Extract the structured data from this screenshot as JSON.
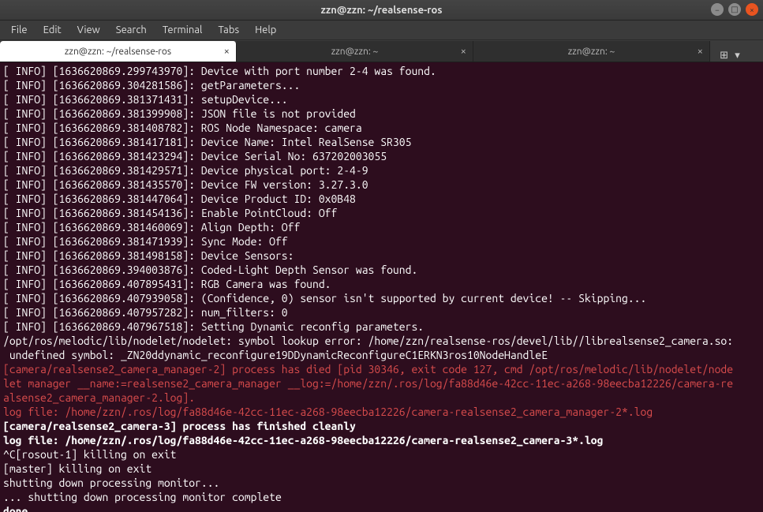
{
  "window": {
    "title": "zzn@zzn: ~/realsense-ros"
  },
  "menu": {
    "file": "File",
    "edit": "Edit",
    "view": "View",
    "search": "Search",
    "terminal": "Terminal",
    "tabs": "Tabs",
    "help": "Help"
  },
  "tabs": [
    {
      "label": "zzn@zzn: ~/realsense-ros",
      "active": true
    },
    {
      "label": "zzn@zzn: ~",
      "active": false
    },
    {
      "label": "zzn@zzn: ~",
      "active": false
    }
  ],
  "lines": [
    {
      "cls": "c-white",
      "text": "[ INFO] [1636620869.299743970]: Device with port number 2-4 was found."
    },
    {
      "cls": "c-white",
      "text": "[ INFO] [1636620869.304281586]: getParameters..."
    },
    {
      "cls": "c-white",
      "text": "[ INFO] [1636620869.381371431]: setupDevice..."
    },
    {
      "cls": "c-white",
      "text": "[ INFO] [1636620869.381399908]: JSON file is not provided"
    },
    {
      "cls": "c-white",
      "text": "[ INFO] [1636620869.381408782]: ROS Node Namespace: camera"
    },
    {
      "cls": "c-white",
      "text": "[ INFO] [1636620869.381417181]: Device Name: Intel RealSense SR305"
    },
    {
      "cls": "c-white",
      "text": "[ INFO] [1636620869.381423294]: Device Serial No: 637202003055"
    },
    {
      "cls": "c-white",
      "text": "[ INFO] [1636620869.381429571]: Device physical port: 2-4-9"
    },
    {
      "cls": "c-white",
      "text": "[ INFO] [1636620869.381435570]: Device FW version: 3.27.3.0"
    },
    {
      "cls": "c-white",
      "text": "[ INFO] [1636620869.381447064]: Device Product ID: 0x0B48"
    },
    {
      "cls": "c-white",
      "text": "[ INFO] [1636620869.381454136]: Enable PointCloud: Off"
    },
    {
      "cls": "c-white",
      "text": "[ INFO] [1636620869.381460069]: Align Depth: Off"
    },
    {
      "cls": "c-white",
      "text": "[ INFO] [1636620869.381471939]: Sync Mode: Off"
    },
    {
      "cls": "c-white",
      "text": "[ INFO] [1636620869.381498158]: Device Sensors: "
    },
    {
      "cls": "c-white",
      "text": "[ INFO] [1636620869.394003876]: Coded-Light Depth Sensor was found."
    },
    {
      "cls": "c-white",
      "text": "[ INFO] [1636620869.407895431]: RGB Camera was found."
    },
    {
      "cls": "c-white",
      "text": "[ INFO] [1636620869.407939058]: (Confidence, 0) sensor isn't supported by current device! -- Skipping..."
    },
    {
      "cls": "c-white",
      "text": "[ INFO] [1636620869.407957282]: num_filters: 0"
    },
    {
      "cls": "c-white",
      "text": "[ INFO] [1636620869.407967518]: Setting Dynamic reconfig parameters."
    },
    {
      "cls": "c-white",
      "text": "/opt/ros/melodic/lib/nodelet/nodelet: symbol lookup error: /home/zzn/realsense-ros/devel/lib//librealsense2_camera.so: undefined symbol: _ZN20ddynamic_reconfigure19DDynamicReconfigureC1ERKN3ros10NodeHandleE"
    },
    {
      "cls": "c-red",
      "text": "[camera/realsense2_camera_manager-2] process has died [pid 30346, exit code 127, cmd /opt/ros/melodic/lib/nodelet/nodelet manager __name:=realsense2_camera_manager __log:=/home/zzn/.ros/log/fa88d46e-42cc-11ec-a268-98eecba12226/camera-realsense2_camera_manager-2.log]."
    },
    {
      "cls": "c-red",
      "text": "log file: /home/zzn/.ros/log/fa88d46e-42cc-11ec-a268-98eecba12226/camera-realsense2_camera_manager-2*.log"
    },
    {
      "cls": "c-bold",
      "text": "[camera/realsense2_camera-3] process has finished cleanly"
    },
    {
      "cls": "c-bold",
      "text": "log file: /home/zzn/.ros/log/fa88d46e-42cc-11ec-a268-98eecba12226/camera-realsense2_camera-3*.log"
    },
    {
      "cls": "c-white",
      "text": "^C[rosout-1] killing on exit"
    },
    {
      "cls": "c-white",
      "text": "[master] killing on exit"
    },
    {
      "cls": "c-white",
      "text": "shutting down processing monitor..."
    },
    {
      "cls": "c-white",
      "text": "... shutting down processing monitor complete"
    },
    {
      "cls": "c-bold",
      "text": "done"
    }
  ]
}
